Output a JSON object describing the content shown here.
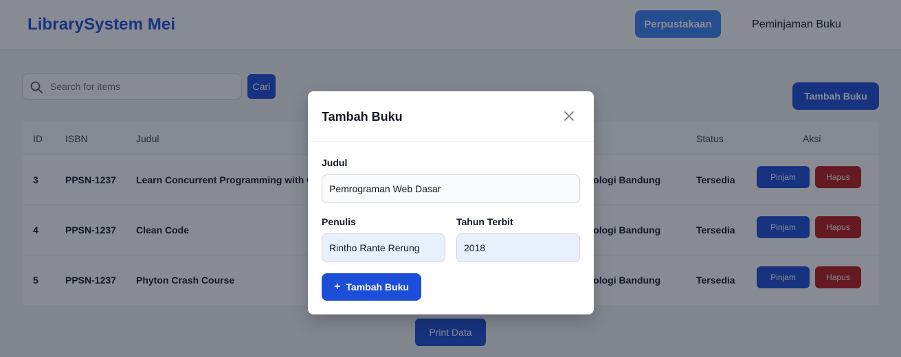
{
  "navbar": {
    "brand": "LibrarySystem Mei",
    "active_button": "Perpustakaan",
    "link": "Peminjaman Buku"
  },
  "toolbar": {
    "search_placeholder": "Search for items",
    "search_button": "Cari",
    "add_button": "Tambah Buku"
  },
  "table": {
    "headers": [
      "ID",
      "ISBN",
      "Judul",
      "Status",
      "Aksi"
    ],
    "rows": [
      {
        "id": "3",
        "isbn": "PPSN-1237",
        "judul": "Learn Concurrent Programming with Go",
        "penerbit": "Institut Teknologi Bandung",
        "status": "Tersedia"
      },
      {
        "id": "4",
        "isbn": "PPSN-1237",
        "judul": "Clean Code",
        "penerbit": "Institut Teknologi Bandung",
        "status": "Tersedia"
      },
      {
        "id": "5",
        "isbn": "PPSN-1237",
        "judul": "Phyton Crash Course",
        "penerbit": "Institut Teknologi Bandung",
        "status": "Tersedia"
      }
    ],
    "pinjam_label": "Pinjam",
    "hapus_label": "Hapus"
  },
  "print_button": "Print Data",
  "modal": {
    "title": "Tambah Buku",
    "judul_label": "Judul",
    "judul_value": "Pemrograman Web Dasar",
    "penulis_label": "Penulis",
    "penulis_value": "Rintho Rante Rerung",
    "tahun_label": "Tahun Terbit",
    "tahun_value": "2018",
    "submit_label": "Tambah Buku",
    "submit_icon": "+"
  },
  "colors": {
    "primary": "#1d4ed8",
    "nav_active": "#3b82f6",
    "danger": "#b91c1c",
    "brand": "#1d4ed8"
  }
}
